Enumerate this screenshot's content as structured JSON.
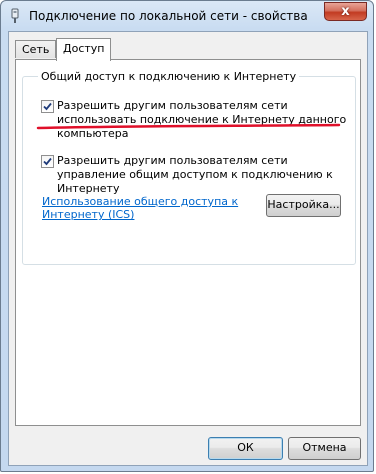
{
  "window": {
    "title": "Подключение по локальной сети - свойства",
    "close_glyph": "x"
  },
  "tabs": [
    {
      "label": "Сеть",
      "active": false
    },
    {
      "label": "Доступ",
      "active": true
    }
  ],
  "sharing": {
    "group_title": "Общий доступ к подключению к Интернету",
    "allow_connection": {
      "label": "Разрешить другим пользователям сети использовать подключение к Интернету данного компьютера",
      "checked": true
    },
    "allow_control": {
      "label": "Разрешить другим пользователям сети управление общим доступом к подключению к Интернету",
      "checked": true
    },
    "ics_link": "Использование общего доступа к Интернету (ICS)",
    "settings_button": "Настройка..."
  },
  "footer": {
    "ok": "ОК",
    "cancel": "Отмена"
  },
  "colors": {
    "annotation_underline": "#e0102a",
    "link": "#0066cc"
  }
}
